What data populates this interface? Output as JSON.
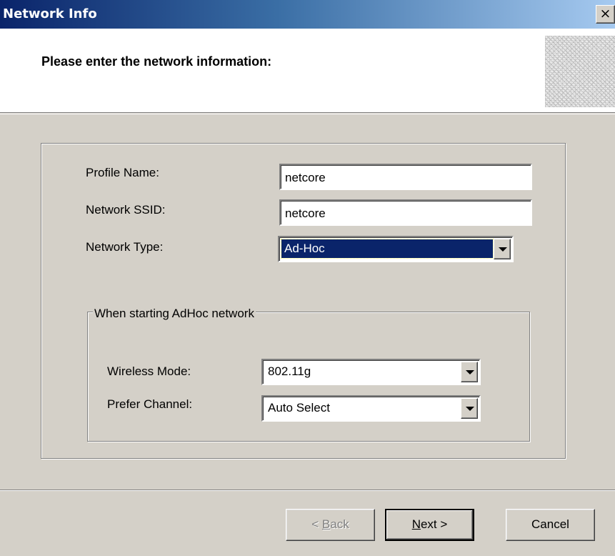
{
  "window": {
    "title": "Network Info",
    "close_glyph": "×"
  },
  "header": {
    "heading": "Please enter the network information:"
  },
  "form": {
    "profile_name": {
      "label": "Profile Name:",
      "value": "netcore"
    },
    "network_ssid": {
      "label": "Network SSID:",
      "value": "netcore"
    },
    "network_type": {
      "label": "Network Type:",
      "value": "Ad-Hoc"
    }
  },
  "adhoc": {
    "legend": "When starting AdHoc network",
    "wireless_mode": {
      "label": "Wireless Mode:",
      "value": "802.11g"
    },
    "prefer_channel": {
      "label": "Prefer Channel:",
      "value": "Auto Select"
    }
  },
  "buttons": {
    "back": {
      "prefix": "< ",
      "accel": "B",
      "rest": "ack"
    },
    "next": {
      "accel": "N",
      "rest": "ext >"
    },
    "cancel": "Cancel"
  },
  "colors": {
    "titlebar_start": "#0a246a",
    "titlebar_end": "#a6caf0",
    "selection": "#0a246a",
    "dialog": "#d4d0c8"
  }
}
